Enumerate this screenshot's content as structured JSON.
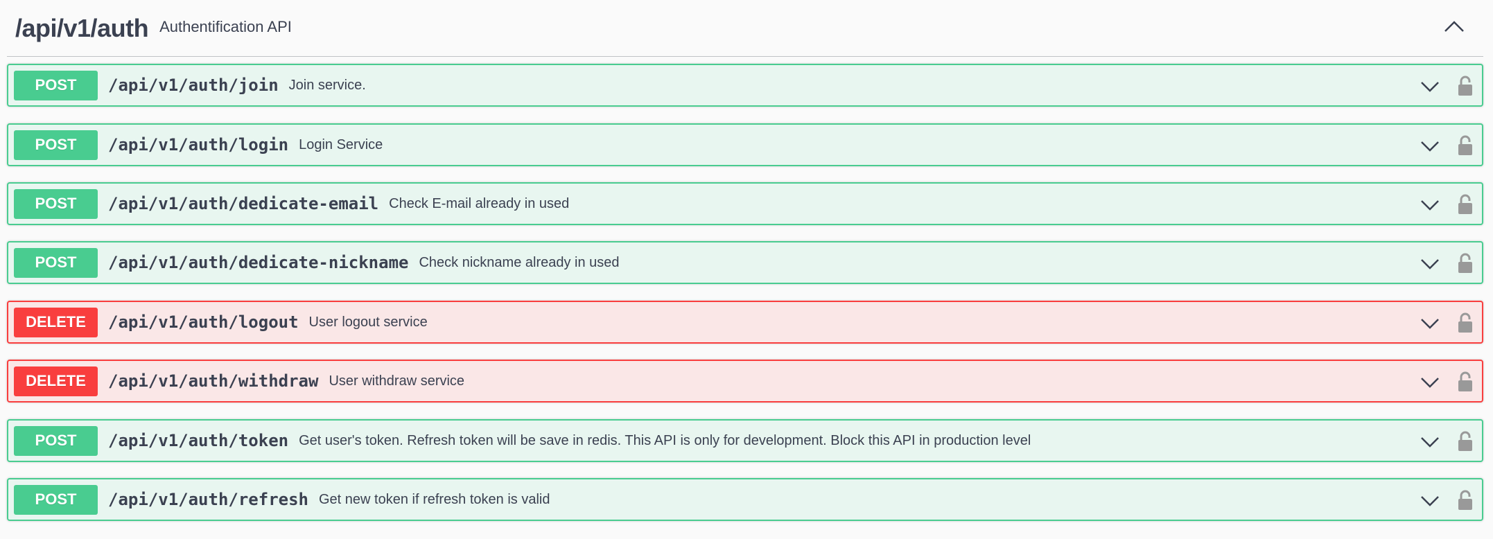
{
  "tag": {
    "name": "/api/v1/auth",
    "description": "Authentification API",
    "toggle_icon": "chevron-up-icon"
  },
  "operations": [
    {
      "method": "POST",
      "path": "/api/v1/auth/join",
      "summary": "Join service."
    },
    {
      "method": "POST",
      "path": "/api/v1/auth/login",
      "summary": "Login Service"
    },
    {
      "method": "POST",
      "path": "/api/v1/auth/dedicate-email",
      "summary": "Check E-mail already in used"
    },
    {
      "method": "POST",
      "path": "/api/v1/auth/dedicate-nickname",
      "summary": "Check nickname already in used"
    },
    {
      "method": "DELETE",
      "path": "/api/v1/auth/logout",
      "summary": "User logout service"
    },
    {
      "method": "DELETE",
      "path": "/api/v1/auth/withdraw",
      "summary": "User withdraw service"
    },
    {
      "method": "POST",
      "path": "/api/v1/auth/token",
      "summary": "Get user's token. Refresh token will be save in redis. This API is only for development. Block this API in production level"
    },
    {
      "method": "POST",
      "path": "/api/v1/auth/refresh",
      "summary": "Get new token if refresh token is valid"
    }
  ],
  "colors": {
    "post": "#49cc90",
    "delete": "#f93e3e",
    "text": "#3b4151",
    "lock": "#999999"
  }
}
